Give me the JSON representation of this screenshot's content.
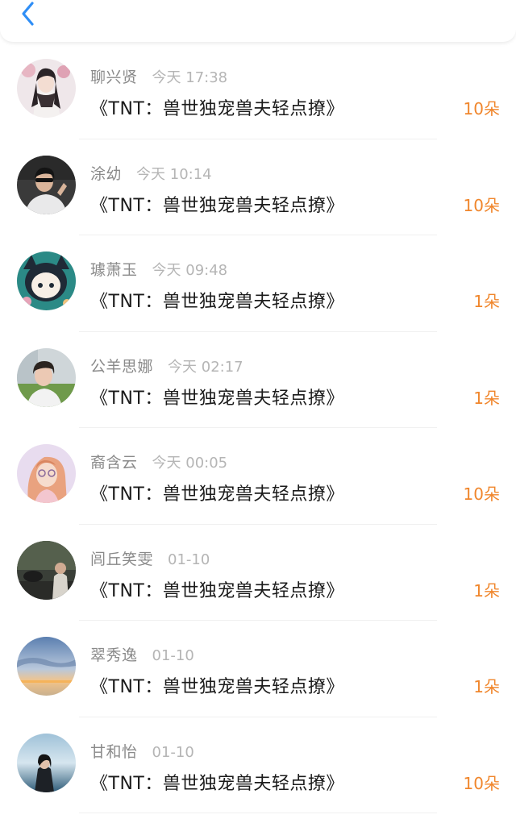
{
  "header": {
    "back_icon": "chevron-left-icon",
    "accent_color": "#2f8ef6"
  },
  "colors": {
    "amount": "#f0862c",
    "username": "#8a8a8a",
    "time": "#b5b5b5",
    "title": "#1b1b1b"
  },
  "rows": [
    {
      "username": "聊兴贤",
      "time": "今天 17:38",
      "title": "《TNT：兽世独宠兽夫轻点撩》",
      "amount": "10朵"
    },
    {
      "username": "涂幼",
      "time": "今天 10:14",
      "title": "《TNT：兽世独宠兽夫轻点撩》",
      "amount": "10朵"
    },
    {
      "username": "璩萧玉",
      "time": "今天 09:48",
      "title": "《TNT：兽世独宠兽夫轻点撩》",
      "amount": "1朵"
    },
    {
      "username": "公羊思娜",
      "time": "今天 02:17",
      "title": "《TNT：兽世独宠兽夫轻点撩》",
      "amount": "1朵"
    },
    {
      "username": "裔含云",
      "time": "今天 00:05",
      "title": "《TNT：兽世独宠兽夫轻点撩》",
      "amount": "10朵"
    },
    {
      "username": "闾丘笑雯",
      "time": "01-10",
      "title": "《TNT：兽世独宠兽夫轻点撩》",
      "amount": "1朵"
    },
    {
      "username": "翠秀逸",
      "time": "01-10",
      "title": "《TNT：兽世独宠兽夫轻点撩》",
      "amount": "1朵"
    },
    {
      "username": "甘和怡",
      "time": "01-10",
      "title": "《TNT：兽世独宠兽夫轻点撩》",
      "amount": "10朵"
    }
  ]
}
